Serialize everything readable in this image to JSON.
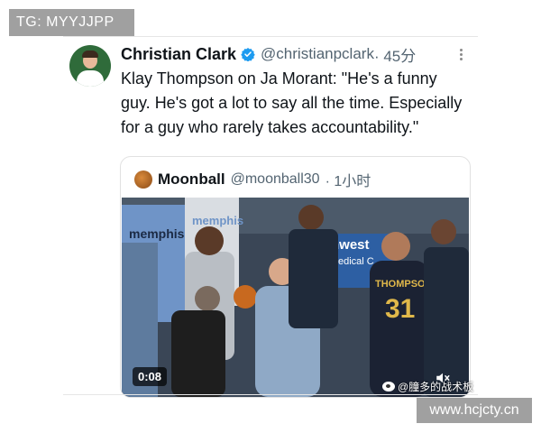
{
  "watermarks": {
    "top_left": "TG: MYYJJPP",
    "bottom_right": "www.hcjcty.cn",
    "weibo_credit": "@膧多的战术板"
  },
  "tweet": {
    "author_name": "Christian Clark",
    "handle": "@christianpclark",
    "time": "· 45分",
    "verified": true,
    "text": "Klay Thompson on Ja Morant: \"He's a funny guy. He's got a lot to say all the time. Especially for a guy who rarely takes accountability.\""
  },
  "quote": {
    "author_name": "Moonball",
    "handle": "@moonball30",
    "time": "· 1小时",
    "video": {
      "duration": "0:08",
      "jersey_name": "THOMPSON",
      "jersey_number": "31",
      "banner_text_1": "memphis",
      "banner_text_2": "memphis",
      "arena_sign": "hwest",
      "arena_sign_2": "edical C"
    }
  },
  "colors": {
    "verified_blue": "#1d9bf0",
    "memphis_blue": "#6f94c7",
    "warriors_navy": "#1b2233"
  },
  "icons": [
    "verified-icon",
    "more-icon",
    "mute-icon",
    "weibo-icon"
  ]
}
